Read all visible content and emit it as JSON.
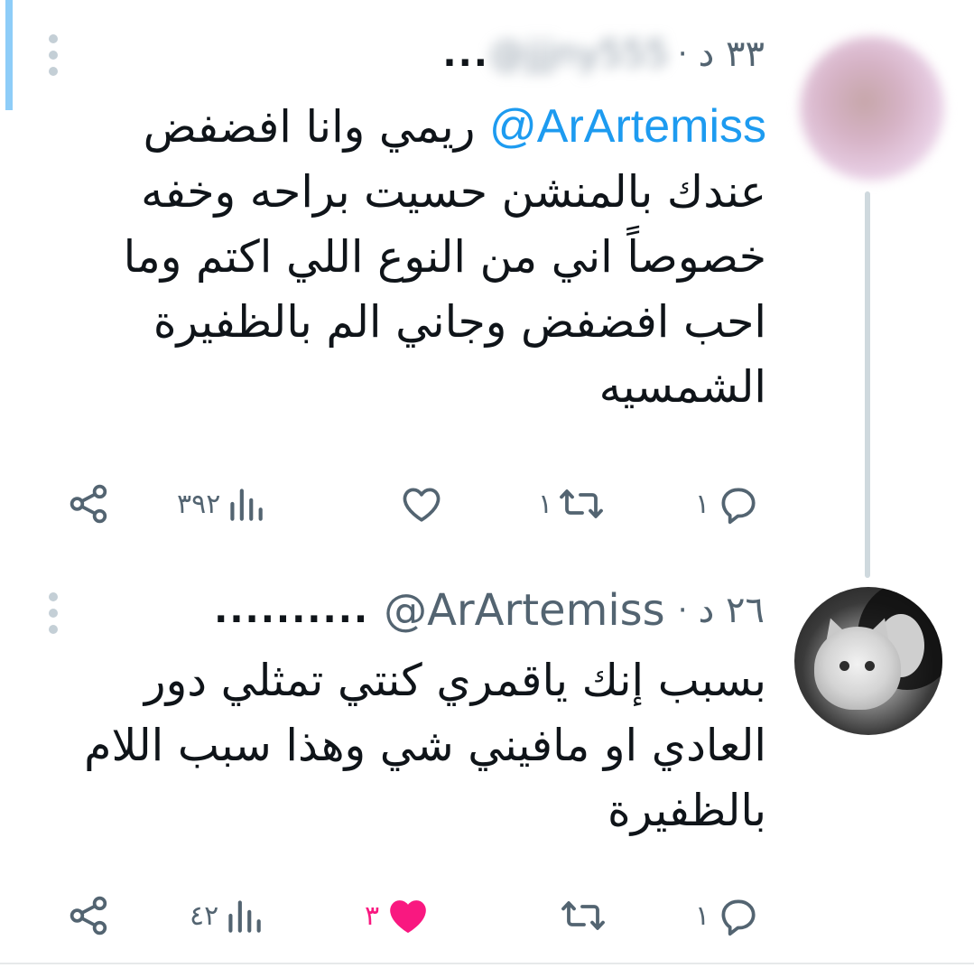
{
  "tweets": [
    {
      "author_name": "...",
      "handle": "@jjjny555",
      "separator": "·",
      "time": "٣٣ د",
      "mention": "@ArArtemiss",
      "text": " ريمي وانا افضفض عندك بالمنشن حسيت براحه وخفه خصوصاً اني من النوع اللي اكتم وما احب افضفض وجاني الم بالظفيرة الشمسيه",
      "actions": {
        "reply_count": "١",
        "retweet_count": "١",
        "like_count": "",
        "views_count": "٣٩٢"
      }
    },
    {
      "author_name": "..........",
      "handle": "@ArArtemiss",
      "separator": "·",
      "time": "٢٦ د",
      "text": "بسبب إنك ياقمري كنتي تمثلي دور العادي او مافيني شي وهذا سبب اللام بالظفيرة",
      "actions": {
        "reply_count": "١",
        "retweet_count": "",
        "like_count": "٣",
        "views_count": "٤٢"
      }
    }
  ],
  "icons": {
    "reply": "reply-icon",
    "retweet": "retweet-icon",
    "like": "heart-icon",
    "like_filled": "heart-filled-icon",
    "views": "views-chart-icon",
    "share": "share-icon",
    "more": "more-vertical-icon"
  },
  "colors": {
    "accent": "#1d9bf0",
    "like_active": "#f91880",
    "icon_gray": "#536471",
    "thread_line": "#cfd9de"
  }
}
